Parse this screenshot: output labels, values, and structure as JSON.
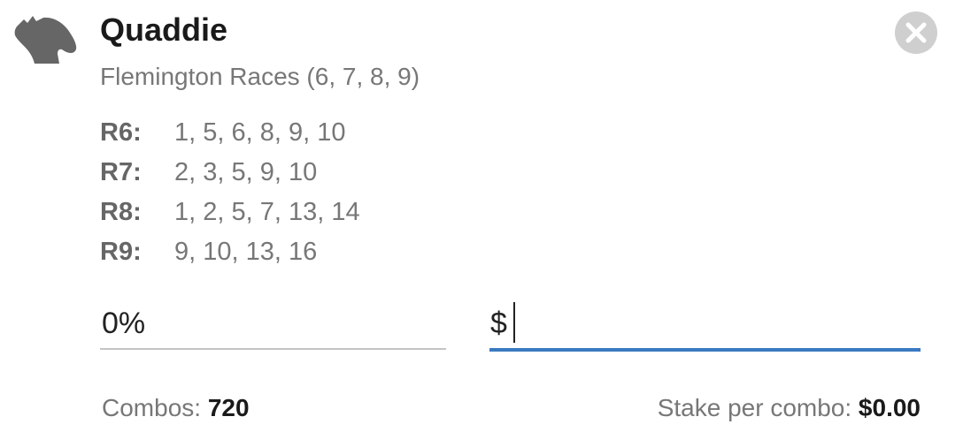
{
  "bet": {
    "icon": "horse-head-icon",
    "title": "Quaddie",
    "meeting": "Flemington Races (6, 7, 8, 9)"
  },
  "close": {
    "icon": "close-icon"
  },
  "selections": [
    {
      "race": "R6:",
      "runners": "1, 5, 6, 8, 9, 10"
    },
    {
      "race": "R7:",
      "runners": "2, 3, 5, 9, 10"
    },
    {
      "race": "R8:",
      "runners": "1, 2, 5, 7, 13, 14"
    },
    {
      "race": "R9:",
      "runners": "9, 10, 13, 16"
    }
  ],
  "percent_field": {
    "value": "0%"
  },
  "stake_field": {
    "currency": "$",
    "value": ""
  },
  "summary": {
    "combos_label": "Combos: ",
    "combos_value": "720",
    "stake_per_combo_label": "Stake per combo: ",
    "stake_per_combo_value": "$0.00"
  },
  "colors": {
    "accent": "#3a7ac2",
    "icon_gray": "#666666",
    "close_bg": "#cfcfcf",
    "muted_text": "#777777"
  }
}
